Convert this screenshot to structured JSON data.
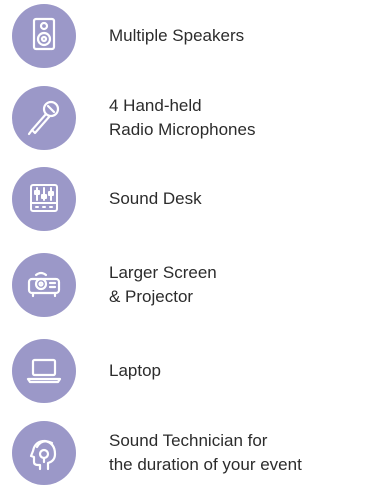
{
  "icon_color": "#9b98c8",
  "text_color": "#2c2c2c",
  "items": [
    {
      "icon": "speaker-icon",
      "lines": [
        "Multiple Speakers"
      ]
    },
    {
      "icon": "microphone-icon",
      "lines": [
        "4 Hand-held",
        "Radio Microphones"
      ]
    },
    {
      "icon": "sound-desk-icon",
      "lines": [
        "Sound Desk"
      ]
    },
    {
      "icon": "projector-icon",
      "lines": [
        "Larger Screen",
        "& Projector"
      ]
    },
    {
      "icon": "laptop-icon",
      "lines": [
        "Laptop"
      ]
    },
    {
      "icon": "sound-technician-icon",
      "lines": [
        "Sound Technician for",
        "the duration of your event"
      ]
    }
  ]
}
